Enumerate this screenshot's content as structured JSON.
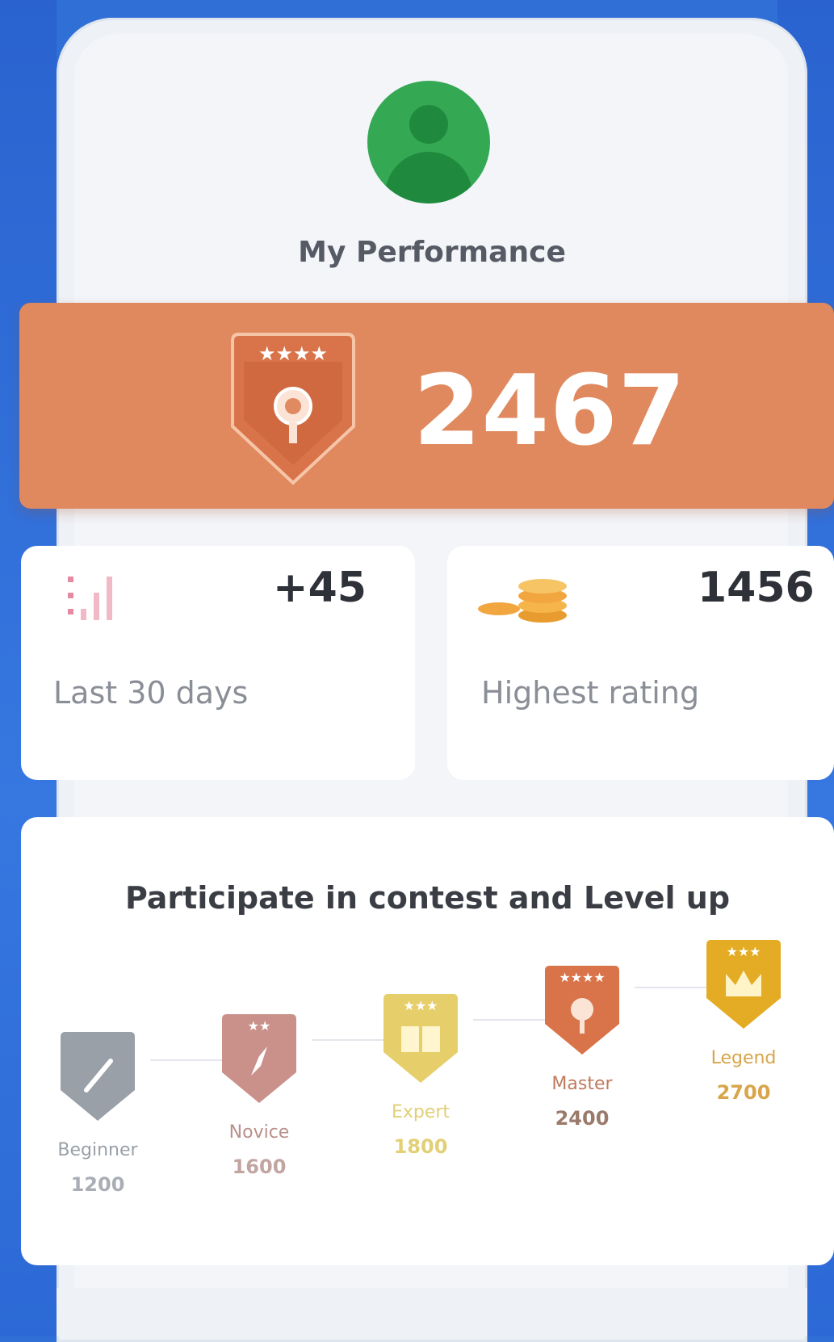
{
  "header": {
    "avatar_icon": "user-avatar-icon",
    "title": "My Performance"
  },
  "rating": {
    "value": "2467",
    "badge_icon": "medal-shield-icon",
    "band_color": "#e0895f"
  },
  "stats": [
    {
      "icon": "bar-signal-icon",
      "value": "+45",
      "label": "Last 30 days"
    },
    {
      "icon": "coin-stack-icon",
      "value": "1456",
      "label": "Highest rating"
    }
  ],
  "levels": {
    "title": "Participate in contest and Level up",
    "items": [
      {
        "name": "Beginner",
        "score": "1200",
        "color": "#9aa0a8",
        "icon": "pen-icon"
      },
      {
        "name": "Novice",
        "score": "1600",
        "color": "#c9918a",
        "icon": "compass-icon"
      },
      {
        "name": "Expert",
        "score": "1800",
        "color": "#e6cf6a",
        "icon": "book-icon"
      },
      {
        "name": "Master",
        "score": "2400",
        "color": "#d9744a",
        "icon": "medal-icon"
      },
      {
        "name": "Legend",
        "score": "2700",
        "color": "#e3ac24",
        "icon": "crown-icon"
      }
    ]
  }
}
